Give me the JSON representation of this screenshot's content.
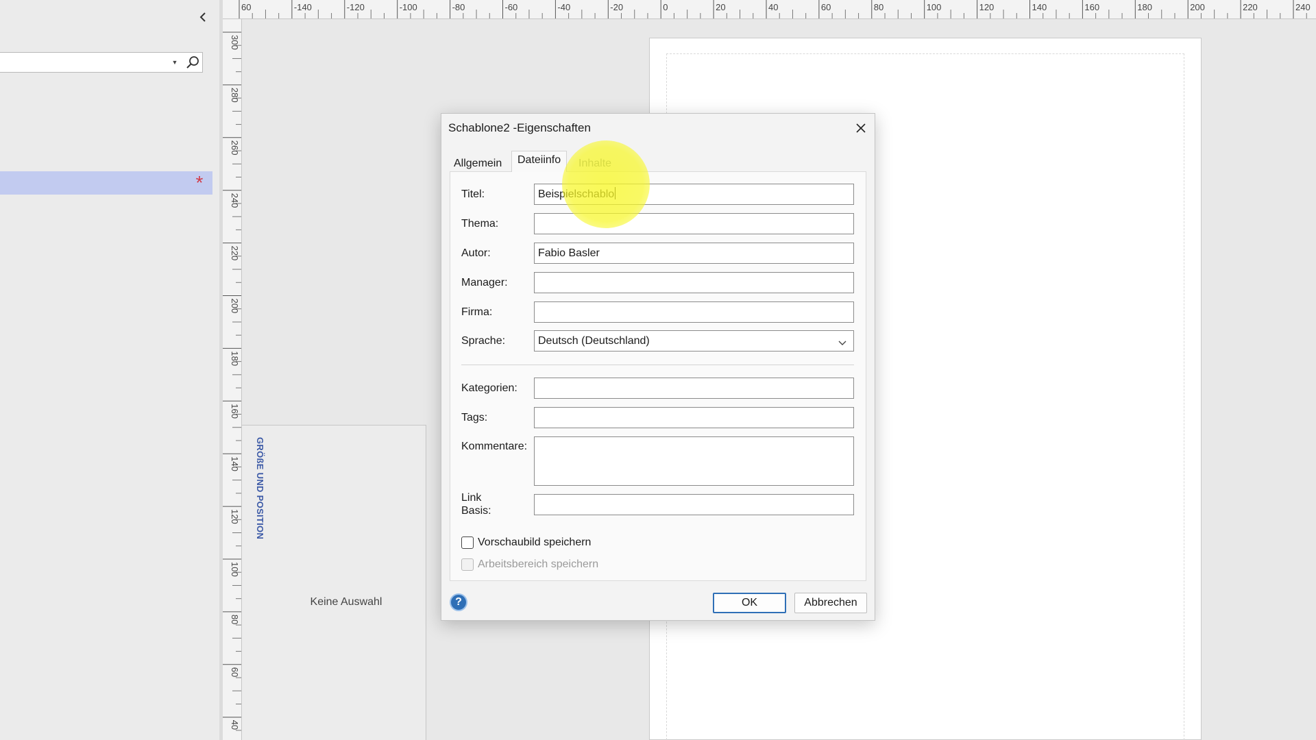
{
  "left_pane": {
    "collapse_icon": "chevron-left-icon",
    "search": {
      "value": "",
      "placeholder": ""
    },
    "dropdown_icon": "caret-down-icon",
    "search_icon": "search-icon",
    "selected_item_icon": "red-asterisk-icon"
  },
  "ruler": {
    "top_labels": [
      "60",
      "-140",
      "-120",
      "-100",
      "-80",
      "-60",
      "-40",
      "-20",
      "0",
      "20",
      "40",
      "60",
      "80",
      "100",
      "120",
      "140",
      "160",
      "180",
      "200",
      "220",
      "240"
    ],
    "left_labels": [
      "300",
      "280",
      "260",
      "240",
      "220",
      "200",
      "180",
      "160",
      "140",
      "120",
      "100",
      "80",
      "60",
      "40"
    ]
  },
  "size_panel": {
    "title": "GRÖßE UND POSITION",
    "empty_text": "Keine Auswahl"
  },
  "dialog": {
    "title": "Schablone2 -Eigenschaften",
    "tabs": [
      {
        "label": "Allgemein"
      },
      {
        "label": "Dateiinfo"
      },
      {
        "label": "Inhalte"
      }
    ],
    "fields": {
      "titel": {
        "label": "Titel:",
        "value": "Beispielschablo"
      },
      "thema": {
        "label": "Thema:",
        "value": ""
      },
      "autor": {
        "label": "Autor:",
        "value": "Fabio Basler"
      },
      "manager": {
        "label": "Manager:",
        "value": ""
      },
      "firma": {
        "label": "Firma:",
        "value": ""
      },
      "sprache": {
        "label": "Sprache:",
        "value": "Deutsch (Deutschland)"
      },
      "kategorien": {
        "label": "Kategorien:",
        "value": ""
      },
      "tags": {
        "label": "Tags:",
        "value": ""
      },
      "kommentare": {
        "label": "Kommentare:",
        "value": ""
      },
      "link_basis": {
        "label_line1": "Link",
        "label_line2": "Basis:",
        "value": ""
      }
    },
    "checkboxes": {
      "preview": {
        "label": "Vorschaubild speichern",
        "checked": false,
        "enabled": true
      },
      "workspace": {
        "label": "Arbeitsbereich speichern",
        "checked": false,
        "enabled": false
      }
    },
    "help_label": "?",
    "ok_label": "OK",
    "cancel_label": "Abbrechen",
    "accent_color": "#2f6fb6"
  }
}
